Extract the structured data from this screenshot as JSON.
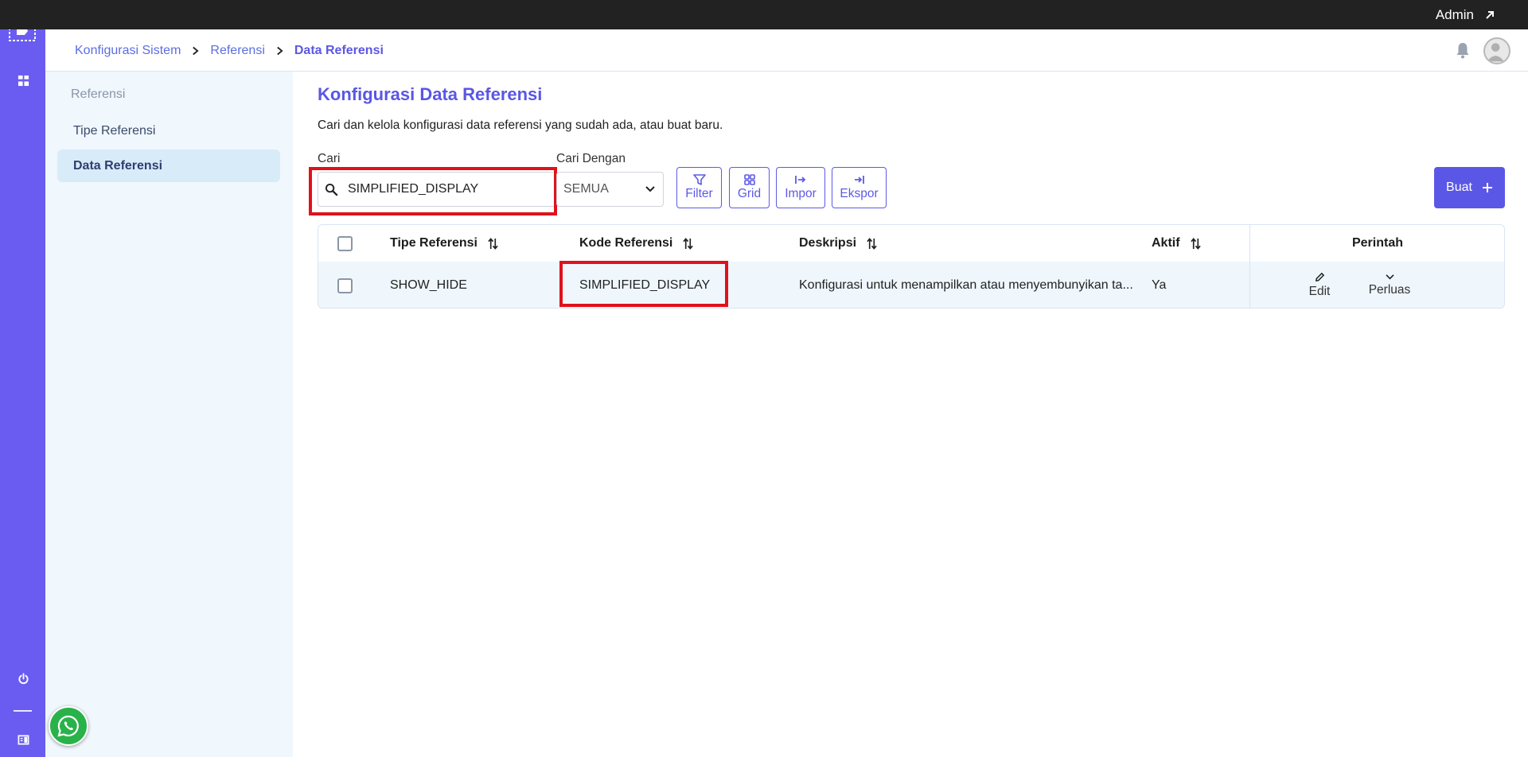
{
  "topbar": {
    "user_label": "Admin"
  },
  "breadcrumb": {
    "items": [
      "Konfigurasi Sistem",
      "Referensi",
      "Data Referensi"
    ]
  },
  "sidebar": {
    "section_title": "Referensi",
    "items": [
      {
        "label": "Tipe Referensi",
        "active": false
      },
      {
        "label": "Data Referensi",
        "active": true
      }
    ]
  },
  "main": {
    "title": "Konfigurasi Data Referensi",
    "description": "Cari dan kelola konfigurasi data referensi yang sudah ada, atau buat baru.",
    "search": {
      "label": "Cari",
      "value": "SIMPLIFIED_DISPLAY",
      "placeholder": ""
    },
    "search_by": {
      "label": "Cari Dengan",
      "value": "SEMUA"
    },
    "toolbar": {
      "filter": "Filter",
      "grid": "Grid",
      "import": "Impor",
      "export": "Ekspor"
    },
    "create_label": "Buat"
  },
  "table": {
    "headers": {
      "tipe": "Tipe Referensi",
      "kode": "Kode Referensi",
      "deskripsi": "Deskripsi",
      "aktif": "Aktif",
      "perintah": "Perintah"
    },
    "rows": [
      {
        "tipe": "SHOW_HIDE",
        "kode": "SIMPLIFIED_DISPLAY",
        "deskripsi": "Konfigurasi untuk menampilkan atau menyembunyikan ta...",
        "aktif": "Ya",
        "actions": {
          "edit": "Edit",
          "expand": "Perluas"
        }
      }
    ]
  },
  "colors": {
    "rail": "#6a5cf0",
    "accent": "#5b57e6",
    "highlight": "#e0121b",
    "topbar": "#222222"
  }
}
